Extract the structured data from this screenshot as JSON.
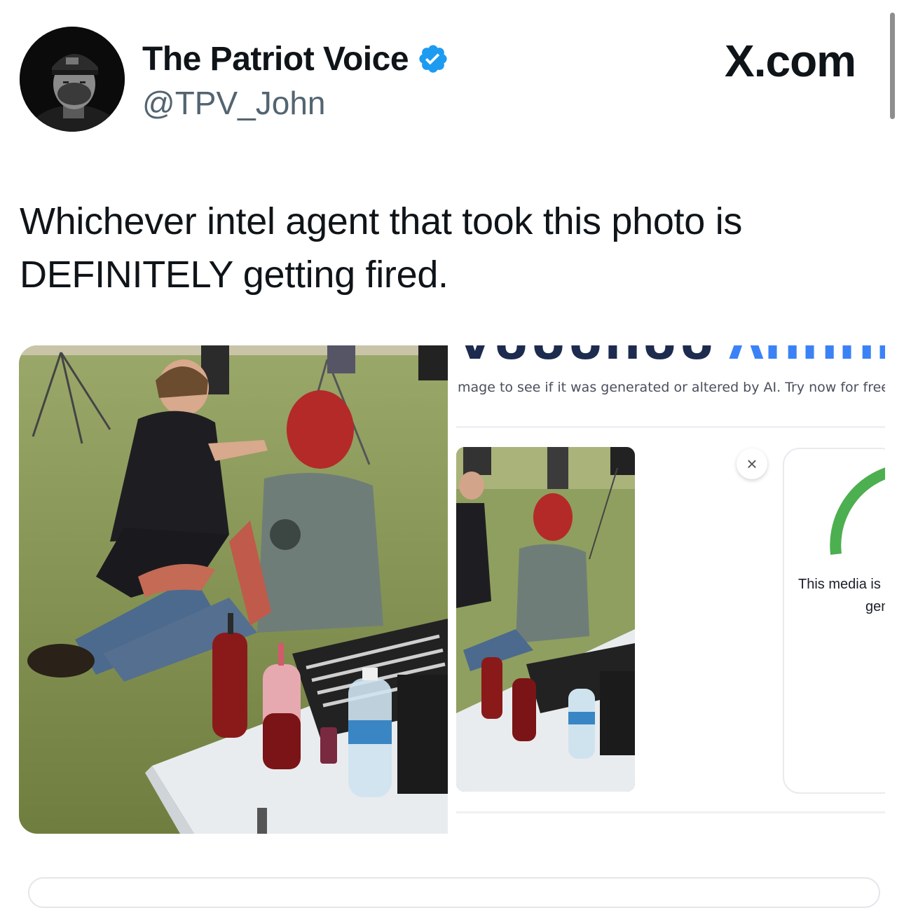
{
  "header": {
    "display_name": "The Patriot Voice",
    "handle": "@TPV_John",
    "brand": "X.com",
    "verified_color": "#1d9bf0"
  },
  "tweet": {
    "text_line1": "Whichever intel agent that took this photo is",
    "text_line2": "DEFINITELY getting fired."
  },
  "media": {
    "screenshot_subline": "mage to see if it was generated or altered by AI. Try now for free",
    "result_text_line1": "This media is",
    "result_text_line2": "gen",
    "close_symbol": "×",
    "gauge_color": "#4caf50"
  }
}
